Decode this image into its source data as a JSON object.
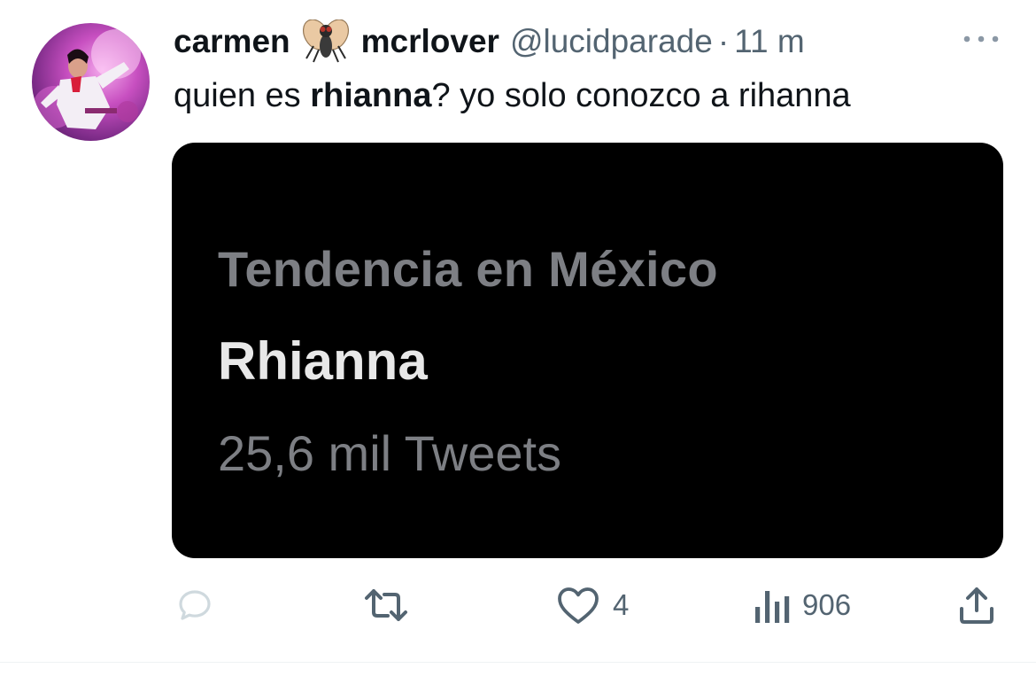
{
  "tweet": {
    "author": {
      "name_part1": "carmen",
      "name_emoji": "fly-emoji",
      "name_part2": "mcrlover",
      "handle": "@lucidparade",
      "separator": "·",
      "time": "11 m"
    },
    "text": {
      "part1": "quien es ",
      "bold": "rhianna",
      "part2": "? yo solo conozco a rihanna"
    },
    "media": {
      "trend_context": "Tendencia en México",
      "trend_name": "Rhianna",
      "trend_count": "25,6 mil Tweets"
    },
    "actions": {
      "reply": {
        "icon": "reply-icon",
        "count": ""
      },
      "retweet": {
        "icon": "retweet-icon",
        "count": ""
      },
      "like": {
        "icon": "heart-icon",
        "count": "4"
      },
      "views": {
        "icon": "views-icon",
        "count": "906"
      },
      "share": {
        "icon": "share-icon"
      }
    }
  },
  "colors": {
    "text_primary": "#0f1419",
    "text_secondary": "#536471",
    "reply_icon_faded": "#cfd9de",
    "media_background": "#000000"
  }
}
